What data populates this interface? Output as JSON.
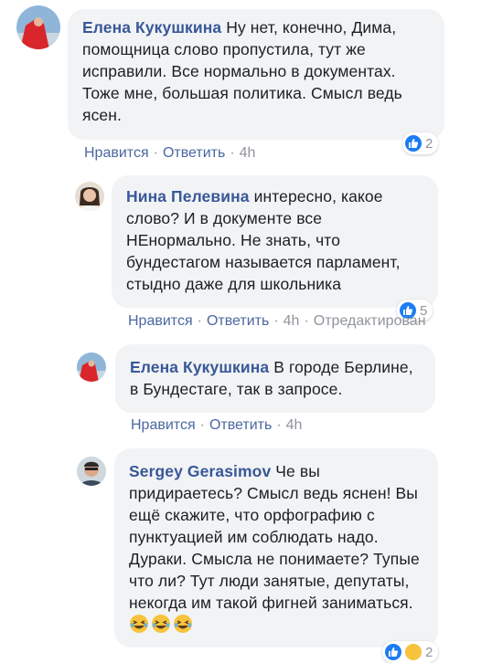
{
  "comments": [
    {
      "author": "Елена Кукушкина",
      "text": " Ну нет, конечно, Дима, помощница слово пропустила, тут же исправили. Все нормально в документах. Тоже мне, большая политика. Смысл ведь ясен.",
      "like_label": "Нравится",
      "reply_label": "Ответить",
      "time": "4h",
      "reaction_count": "2"
    },
    {
      "author": "Нина Пелевина",
      "text": " интересно, какое слово? И в документе все НЕнормально. Не знать, что бундестагом называется парламент, стыдно даже для школьника",
      "like_label": "Нравится",
      "reply_label": "Ответить",
      "time": "4h",
      "edited_label": "Отредактирован",
      "reaction_count": "5"
    },
    {
      "author": "Елена Кукушкина",
      "text": " В городе Берлине, в Бундестаге, так в запросе.",
      "like_label": "Нравится",
      "reply_label": "Ответить",
      "time": "4h"
    },
    {
      "author": "Sergey Gerasimov",
      "text": " Че вы придираетесь? Смысл ведь яснен! Вы ещё скажите, что орфографию с пунктуацией им соблюдать надо. Дураки. Смысла не понимаете? Тупые что ли? Тут люди занятые, депутаты, некогда им такой фигней заниматься.",
      "reaction_count": "2"
    }
  ],
  "separator": "·",
  "colors": {
    "author": "#385898",
    "link": "#4b67a1",
    "meta": "#90949c",
    "bubble": "#f2f3f5",
    "like_blue": "#1d7cf2"
  }
}
